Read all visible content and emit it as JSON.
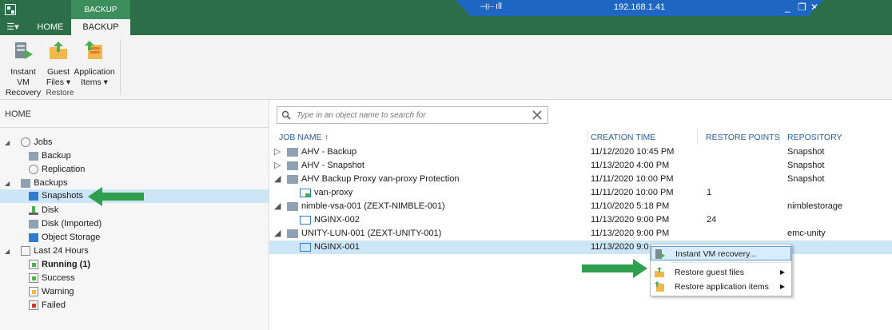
{
  "ribbon": {
    "context_group": "BACKUP TOOLS",
    "menu_glyph": "☰▾",
    "tabs": [
      {
        "label": "HOME"
      },
      {
        "label": "BACKUP"
      }
    ],
    "buttons": [
      {
        "line1": "Instant VM",
        "line2": "Recovery",
        "icon": "instant-vm-icon"
      },
      {
        "line1": "Guest",
        "line2": "Files ▾",
        "icon": "guest-files-icon"
      },
      {
        "line1": "Application",
        "line2": "Items ▾",
        "icon": "application-items-icon"
      }
    ],
    "group_label": "Restore"
  },
  "remote_bar": {
    "ip": "192.168.1.41",
    "controls": [
      "_",
      "❐",
      "✕"
    ],
    "pin_glyph": "⊣⊢",
    "signal_glyph": "ıll"
  },
  "nav": {
    "header": "HOME",
    "tree": [
      {
        "label": "Jobs",
        "level": 0,
        "expand": "◢",
        "icon": "jobs-icon"
      },
      {
        "label": "Backup",
        "level": 1,
        "icon": "backup-job-icon"
      },
      {
        "label": "Replication",
        "level": 1,
        "icon": "replication-icon"
      },
      {
        "label": "Backups",
        "level": 0,
        "expand": "◢",
        "icon": "backups-icon"
      },
      {
        "label": "Snapshots",
        "level": 1,
        "icon": "snapshots-icon",
        "selected": true
      },
      {
        "label": "Disk",
        "level": 1,
        "icon": "disk-icon"
      },
      {
        "label": "Disk (Imported)",
        "level": 1,
        "icon": "disk-imported-icon"
      },
      {
        "label": "Object Storage",
        "level": 1,
        "icon": "object-storage-icon"
      },
      {
        "label": "Last 24 Hours",
        "level": 0,
        "expand": "◢",
        "icon": "last-24-icon"
      },
      {
        "label": "Running (1)",
        "level": 1,
        "icon": "running-icon",
        "bold": true
      },
      {
        "label": "Success",
        "level": 1,
        "icon": "success-icon"
      },
      {
        "label": "Warning",
        "level": 1,
        "icon": "warning-icon"
      },
      {
        "label": "Failed",
        "level": 1,
        "icon": "failed-icon"
      }
    ]
  },
  "search": {
    "placeholder": "Type in an object name to search for"
  },
  "table": {
    "columns": [
      "JOB NAME ↑",
      "CREATION TIME",
      "RESTORE POINTS",
      "REPOSITORY"
    ],
    "rows": [
      {
        "name": "AHV - Backup",
        "time": "11/12/2020 10:45 PM",
        "points": "",
        "repo": "Snapshot",
        "level": 0,
        "expand": "▷"
      },
      {
        "name": "AHV - Snapshot",
        "time": "11/13/2020 4:00 PM",
        "points": "",
        "repo": "Snapshot",
        "level": 0,
        "expand": "▷"
      },
      {
        "name": "AHV Backup Proxy van-proxy Protection",
        "time": "11/11/2020 10:00 PM",
        "points": "",
        "repo": "Snapshot",
        "level": 0,
        "expand": "◢"
      },
      {
        "name": "van-proxy",
        "time": "11/11/2020 10:00 PM",
        "points": "1",
        "repo": "",
        "level": 1,
        "expand": ""
      },
      {
        "name": "nimble-vsa-001 (ZEXT-NIMBLE-001)",
        "time": "11/10/2020 5:18 PM",
        "points": "",
        "repo": "nimblestorage",
        "level": 0,
        "expand": "◢"
      },
      {
        "name": "NGINX-002",
        "time": "11/13/2020 9:00 PM",
        "points": "24",
        "repo": "",
        "level": 1,
        "expand": ""
      },
      {
        "name": "UNITY-LUN-001 (ZEXT-UNITY-001)",
        "time": "11/13/2020 9:00 PM",
        "points": "",
        "repo": "emc-unity",
        "level": 0,
        "expand": "◢"
      },
      {
        "name": "NGINX-001",
        "time": "11/13/2020 9:0",
        "points": "",
        "repo": "",
        "level": 1,
        "expand": "",
        "selected": true
      }
    ]
  },
  "context_menu": {
    "items": [
      {
        "label": "Instant VM recovery...",
        "icon": "instant-vm-icon",
        "highlighted": true,
        "submenu": false
      },
      {
        "label": "Restore guest files",
        "icon": "guest-files-icon",
        "submenu": true
      },
      {
        "label": "Restore application items",
        "icon": "application-items-icon",
        "submenu": true
      }
    ],
    "submenu_glyph": "▶"
  },
  "colors": {
    "brand": "#2b6e47",
    "selection": "#cde6f7",
    "link": "#2a5d9a",
    "arrow": "#2f9e4f"
  }
}
